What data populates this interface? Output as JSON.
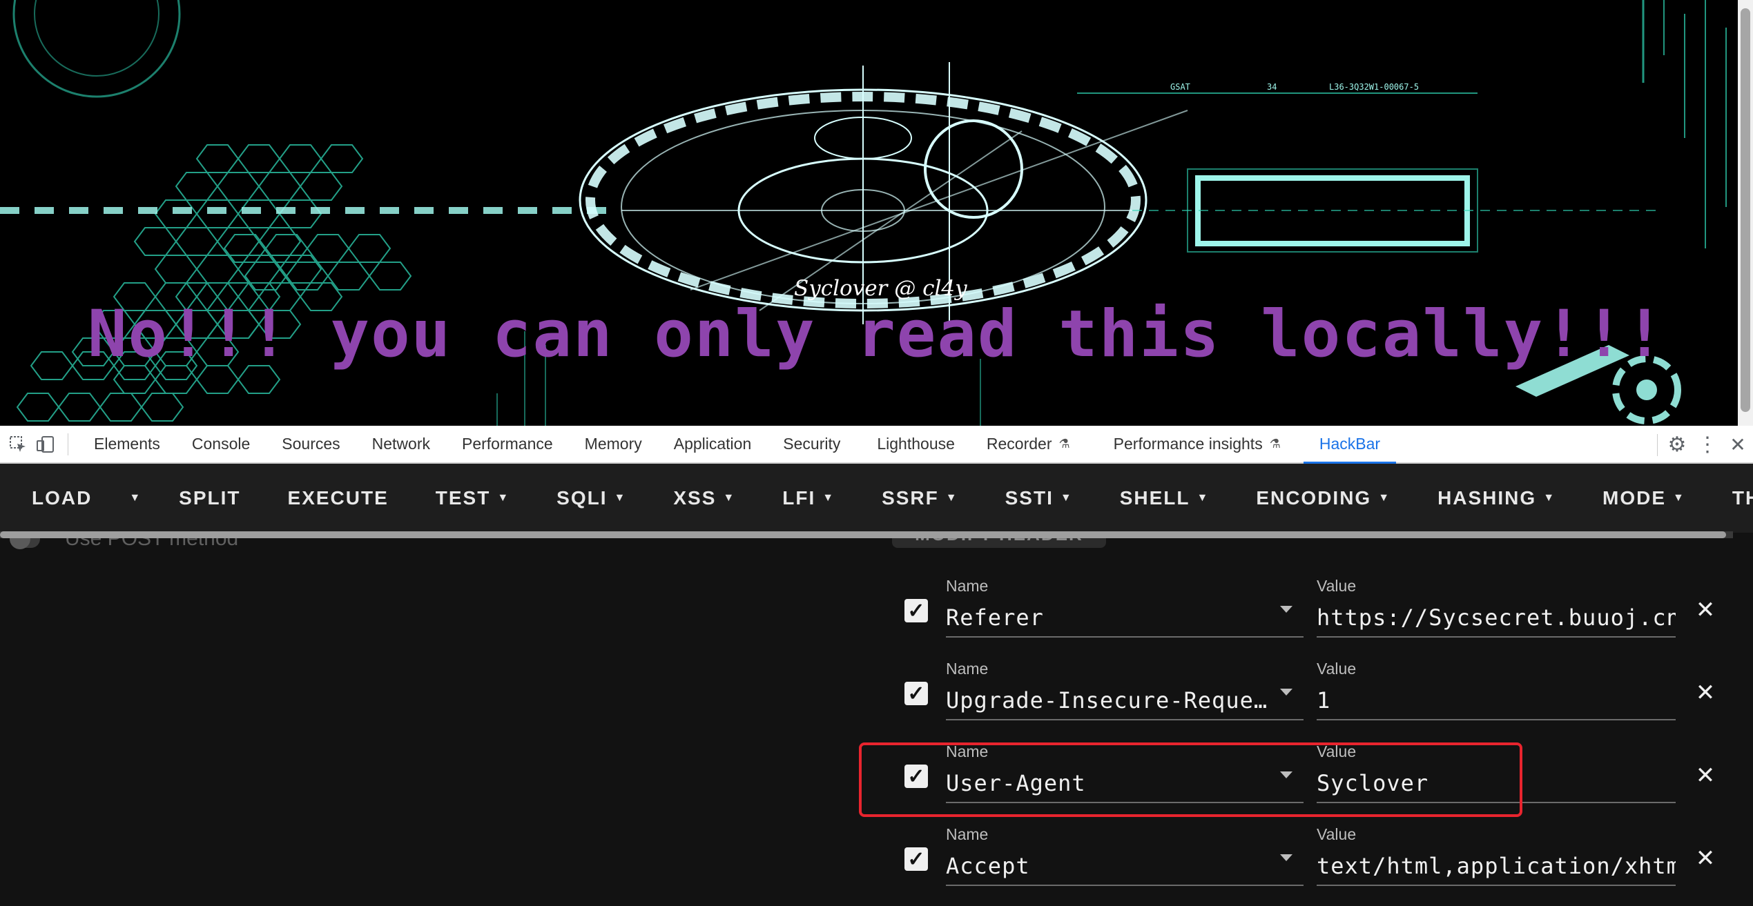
{
  "page": {
    "message": "No!!! you can only read this locally!!!",
    "watermark": "Syclover @ cl4y",
    "hud_text_1": "GSAT",
    "hud_text_2": "34",
    "hud_text_3": "L36-3Q32W1-00067-5"
  },
  "devtools": {
    "tabs": [
      {
        "label": "Elements"
      },
      {
        "label": "Console"
      },
      {
        "label": "Sources"
      },
      {
        "label": "Network"
      },
      {
        "label": "Performance"
      },
      {
        "label": "Memory"
      },
      {
        "label": "Application"
      },
      {
        "label": "Security"
      },
      {
        "label": "Lighthouse"
      },
      {
        "label": "Recorder"
      },
      {
        "label": "Performance insights"
      },
      {
        "label": "HackBar"
      }
    ],
    "active_tab": "HackBar",
    "accent_color": "#1a73e8"
  },
  "hackbar": {
    "menu": {
      "load": "LOAD",
      "split": "SPLIT",
      "execute": "EXECUTE",
      "test": "TEST",
      "sqli": "SQLI",
      "xss": "XSS",
      "lfi": "LFI",
      "ssrf": "SSRF",
      "ssti": "SSTI",
      "shell": "SHELL",
      "encoding": "ENCODING",
      "hashing": "HASHING",
      "mode": "MODE",
      "theme": "THEME"
    },
    "post_toggle_label": "Use POST method",
    "modify_header_label": "MODIFY HEADER",
    "name_label": "Name",
    "value_label": "Value",
    "headers": [
      {
        "enabled": true,
        "name": "Referer",
        "value": "https://Sycsecret.buuoj.cn"
      },
      {
        "enabled": true,
        "name": "Upgrade-Insecure-Requests",
        "value": "1"
      },
      {
        "enabled": true,
        "name": "User-Agent",
        "value": "Syclover"
      },
      {
        "enabled": true,
        "name": "Accept",
        "value": "text/html,application/xhtml+xml,application/xml"
      }
    ],
    "highlight_color": "#e8242e",
    "message_color": "#8e44ad"
  }
}
